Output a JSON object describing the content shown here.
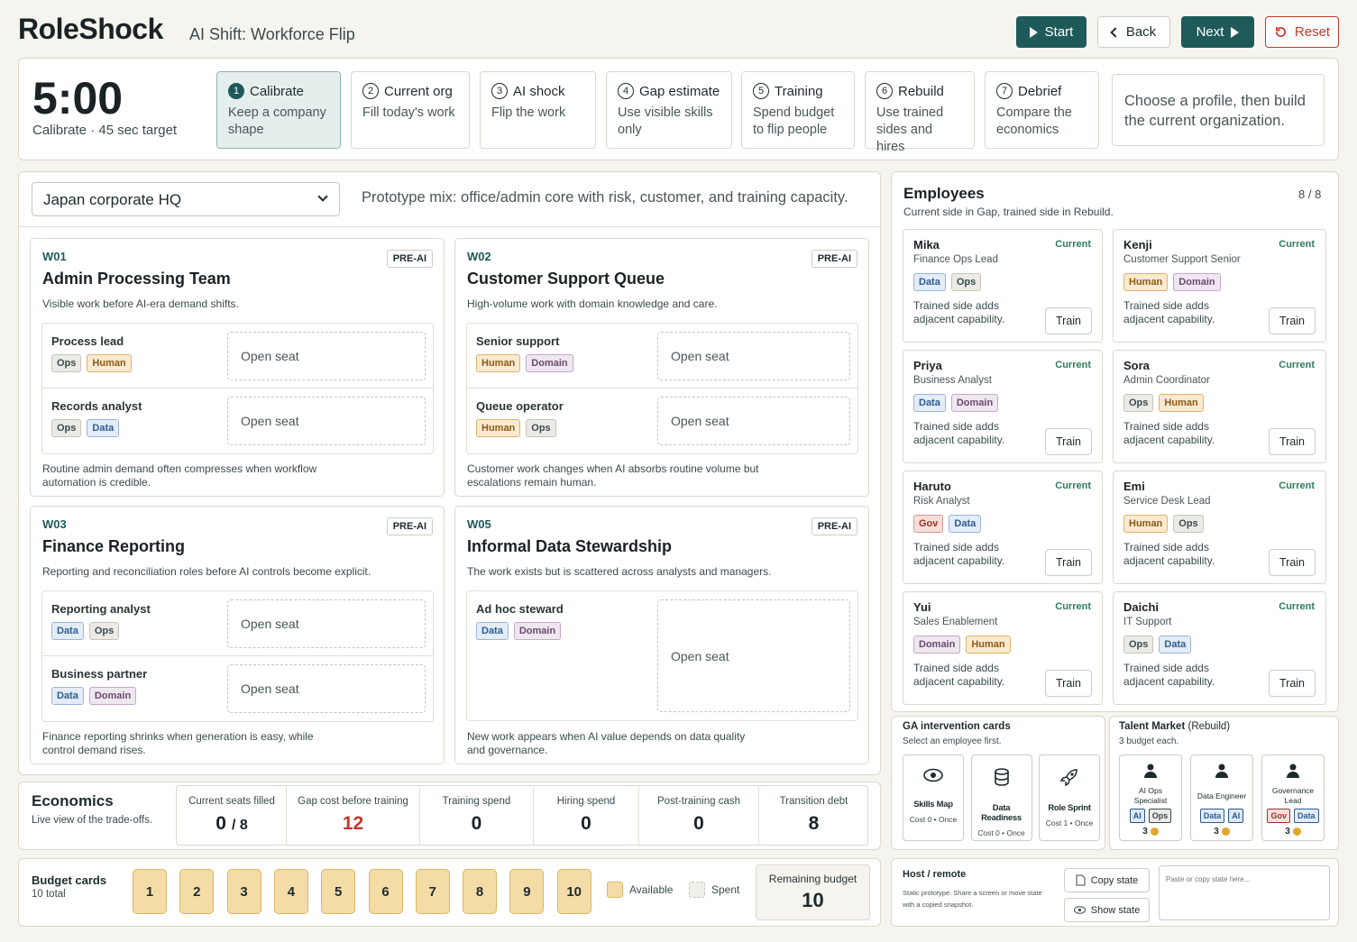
{
  "app": {
    "logo": "RoleShock",
    "subtitle": "AI Shift: Workforce Flip"
  },
  "toolbar": {
    "start": "Start",
    "back": "Back",
    "next": "Next",
    "reset": "Reset"
  },
  "timer": {
    "value": "5:00",
    "sub": "Calibrate · 45 sec target"
  },
  "steps": [
    {
      "num": "1",
      "title": "Calibrate",
      "desc": "Keep a company shape",
      "active": true
    },
    {
      "num": "2",
      "title": "Current org",
      "desc": "Fill today's work"
    },
    {
      "num": "3",
      "title": "AI shock",
      "desc": "Flip the work"
    },
    {
      "num": "4",
      "title": "Gap estimate",
      "desc": "Use visible skills only"
    },
    {
      "num": "5",
      "title": "Training",
      "desc": "Spend budget to flip people"
    },
    {
      "num": "6",
      "title": "Rebuild",
      "desc": "Use trained sides and hires"
    },
    {
      "num": "7",
      "title": "Debrief",
      "desc": "Compare the economics"
    }
  ],
  "hint": "Choose a profile, then build the current organization.",
  "profile": {
    "selected": "Japan corporate HQ",
    "note": "Prototype mix: office/admin core with risk, customer, and training capacity."
  },
  "work": [
    {
      "id": "W01",
      "badge": "PRE-AI",
      "title": "Admin Processing Team",
      "desc": "Visible work before AI-era demand shifts.",
      "roles": [
        {
          "name": "Process lead",
          "tags": [
            "Ops",
            "Human"
          ],
          "seat": "Open seat"
        },
        {
          "name": "Records analyst",
          "tags": [
            "Ops",
            "Data"
          ],
          "seat": "Open seat"
        }
      ],
      "foot": "Routine admin demand often compresses when workflow automation is credible."
    },
    {
      "id": "W02",
      "badge": "PRE-AI",
      "title": "Customer Support Queue",
      "desc": "High-volume work with domain knowledge and care.",
      "roles": [
        {
          "name": "Senior support",
          "tags": [
            "Human",
            "Domain"
          ],
          "seat": "Open seat"
        },
        {
          "name": "Queue operator",
          "tags": [
            "Human",
            "Ops"
          ],
          "seat": "Open seat"
        }
      ],
      "foot": "Customer work changes when AI absorbs routine volume but escalations remain human."
    },
    {
      "id": "W03",
      "badge": "PRE-AI",
      "title": "Finance Reporting",
      "desc": "Reporting and reconciliation roles before AI controls become explicit.",
      "roles": [
        {
          "name": "Reporting analyst",
          "tags": [
            "Data",
            "Ops"
          ],
          "seat": "Open seat"
        },
        {
          "name": "Business partner",
          "tags": [
            "Data",
            "Domain"
          ],
          "seat": "Open seat"
        }
      ],
      "foot": "Finance reporting shrinks when generation is easy, while control demand rises."
    },
    {
      "id": "W05",
      "badge": "PRE-AI",
      "title": "Informal Data Stewardship",
      "desc": "The work exists but is scattered across analysts and managers.",
      "roles": [
        {
          "name": "Ad hoc steward",
          "tags": [
            "Data",
            "Domain"
          ],
          "seat": "Open seat"
        }
      ],
      "foot": "New work appears when AI value depends on data quality and governance."
    }
  ],
  "employees": {
    "title": "Employees",
    "subtitle": "Current side in Gap, trained side in Rebuild.",
    "count": "8 / 8",
    "status": "Current",
    "note": "Trained side adds adjacent capability.",
    "train": "Train",
    "list": [
      {
        "name": "Mika",
        "role": "Finance Ops Lead",
        "tags": [
          "Data",
          "Ops"
        ]
      },
      {
        "name": "Kenji",
        "role": "Customer Support Senior",
        "tags": [
          "Human",
          "Domain"
        ]
      },
      {
        "name": "Priya",
        "role": "Business Analyst",
        "tags": [
          "Data",
          "Domain"
        ]
      },
      {
        "name": "Sora",
        "role": "Admin Coordinator",
        "tags": [
          "Ops",
          "Human"
        ]
      },
      {
        "name": "Haruto",
        "role": "Risk Analyst",
        "tags": [
          "Gov",
          "Data"
        ]
      },
      {
        "name": "Emi",
        "role": "Service Desk Lead",
        "tags": [
          "Human",
          "Ops"
        ]
      },
      {
        "name": "Yui",
        "role": "Sales Enablement",
        "tags": [
          "Domain",
          "Human"
        ]
      },
      {
        "name": "Daichi",
        "role": "IT Support",
        "tags": [
          "Ops",
          "Data"
        ]
      }
    ]
  },
  "economics": {
    "title": "Economics",
    "subtitle": "Live view of the trade-offs.",
    "metrics": [
      {
        "label": "Current seats filled",
        "value": "0",
        "suffix": "/ 8"
      },
      {
        "label": "Gap cost before training",
        "value": "12",
        "color": "#c0392b"
      },
      {
        "label": "Training spend",
        "value": "0"
      },
      {
        "label": "Hiring spend",
        "value": "0"
      },
      {
        "label": "Post-training cash",
        "value": "0"
      },
      {
        "label": "Transition debt",
        "value": "8"
      }
    ]
  },
  "budget": {
    "title": "Budget cards",
    "sub": "10 total",
    "cards": [
      "1",
      "2",
      "3",
      "4",
      "5",
      "6",
      "7",
      "8",
      "9",
      "10"
    ],
    "available": "Available",
    "spent": "Spent",
    "remaining_label": "Remaining budget",
    "remaining": "10"
  },
  "ga": {
    "title": "GA intervention cards",
    "sub": "Select an employee first.",
    "cards": [
      {
        "name": "Skills Map",
        "cost": "Cost 0 • Once",
        "icon": "eye-icon"
      },
      {
        "name": "Data Readiness",
        "cost": "Cost 0 • Once",
        "icon": "database-icon"
      },
      {
        "name": "Role Sprint",
        "cost": "Cost 1 • Once",
        "icon": "rocket-icon"
      }
    ]
  },
  "talent": {
    "title": "Talent Market",
    "tag": "(Rebuild)",
    "sub": "3 budget each.",
    "cards": [
      {
        "name": "AI Ops Specialist",
        "tags": [
          "AI",
          "Ops"
        ],
        "cost": "3"
      },
      {
        "name": "Data Engineer",
        "tags": [
          "Data",
          "AI"
        ],
        "cost": "3"
      },
      {
        "name": "Governance Lead",
        "tags": [
          "Gov",
          "Data"
        ],
        "cost": "3"
      }
    ]
  },
  "host": {
    "title": "Host / remote",
    "desc": "Static prototype. Share a screen or move state with a copied snapshot.",
    "copy": "Copy state",
    "show": "Show state",
    "placeholder": "Paste or copy state here..."
  }
}
